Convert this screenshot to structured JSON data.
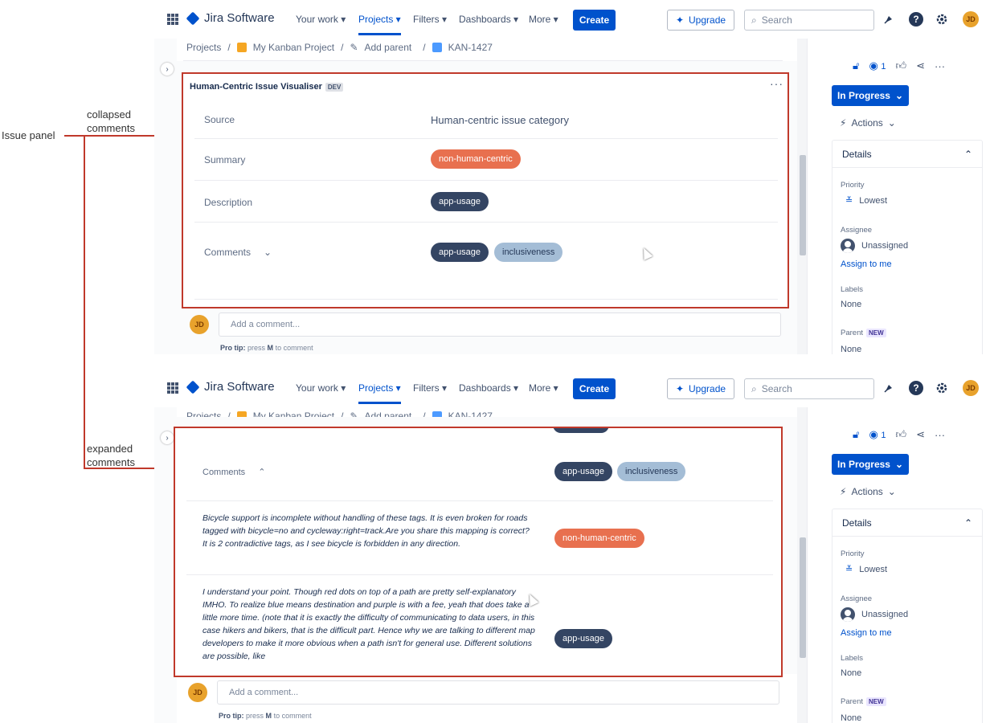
{
  "annotations": {
    "issue_panel": "Issue panel",
    "collapsed_comments": [
      "collapsed",
      "comments"
    ],
    "expanded_comments": [
      "expanded",
      "comments"
    ]
  },
  "colors": {
    "accent": "#0052cc",
    "annotation": "#c0392b",
    "tag_orange": "#e8704f",
    "tag_navy": "#344563",
    "tag_light": "#a4bdd6"
  },
  "nav": {
    "app_name": "Jira Software",
    "items": [
      "Your work ▾",
      "Projects ▾",
      "Filters ▾",
      "Dashboards ▾",
      "More ▾"
    ],
    "create": "Create",
    "upgrade": "Upgrade",
    "search_placeholder": "Search",
    "avatar_initials": "JD"
  },
  "breadcrumb": {
    "projects": "Projects",
    "project": "My Kanban Project",
    "add_parent": "Add parent",
    "issue_key": "KAN-1427"
  },
  "panel": {
    "title": "Human-Centric Issue Visualiser",
    "dev_tag": "DEV",
    "source_label": "Source",
    "category_header": "Human-centric issue category",
    "summary_label": "Summary",
    "description_label": "Description",
    "comments_label": "Comments",
    "tags": {
      "non_human_centric": "non-human-centric",
      "app_usage": "app-usage",
      "inclusiveness": "inclusiveness"
    }
  },
  "comments_expanded": [
    {
      "text": "Bicycle support is incomplete without handling of these tags. It is even broken for roads tagged with bicycle=no and cycleway:right=track.Are you share this mapping is correct? It is 2 contradictive tags, as I see bicycle is forbidden in any direction.",
      "tag": "non-human-centric"
    },
    {
      "text": "I understand your point. Though red dots on top of a path are pretty self-explanatory IMHO. To realize blue means destination and purple is with a fee, yeah that does take a little more time. (note that it is exactly the difficulty of communicating to data users, in this case hikers and bikers, that is the difficult part. Hence why we are talking to different map developers to make it more obvious when a path isn't for general use. Different solutions are possible, like",
      "tag": "app-usage"
    }
  ],
  "comment_box": {
    "avatar": "JD",
    "placeholder": "Add a comment...",
    "protip_prefix": "Pro tip:",
    "protip_middle": "press",
    "protip_key": "M",
    "protip_suffix": "to comment"
  },
  "sidebar": {
    "watch_count": "1",
    "status": "In Progress",
    "actions": "Actions",
    "details": "Details",
    "priority_label": "Priority",
    "priority_value": "Lowest",
    "assignee_label": "Assignee",
    "assignee_value": "Unassigned",
    "assign_to_me": "Assign to me",
    "labels_label": "Labels",
    "labels_value": "None",
    "parent_label": "Parent",
    "new_badge": "NEW",
    "parent_value": "None"
  }
}
